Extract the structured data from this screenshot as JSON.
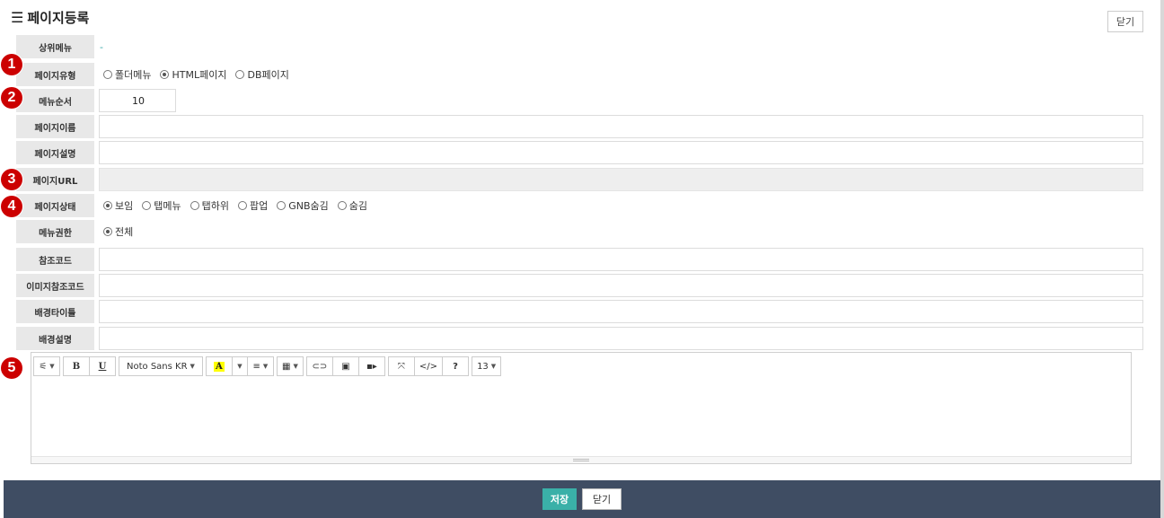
{
  "header": {
    "menu_icon": "☰",
    "title": "페이지등록",
    "close_label": "닫기"
  },
  "badges": [
    "1",
    "2",
    "3",
    "4",
    "5"
  ],
  "form": {
    "parent_menu": {
      "label": "상위메뉴",
      "value": "-"
    },
    "page_type": {
      "label": "페이지유형",
      "options": [
        "폴더메뉴",
        "HTML페이지",
        "DB페이지"
      ],
      "selected": "HTML페이지"
    },
    "menu_order": {
      "label": "메뉴순서",
      "value": "10"
    },
    "page_name": {
      "label": "페이지이름",
      "value": ""
    },
    "page_desc": {
      "label": "페이지설명",
      "value": ""
    },
    "page_url": {
      "label": "페이지URL",
      "value": ""
    },
    "page_status": {
      "label": "페이지상태",
      "options": [
        "보임",
        "탭메뉴",
        "탭하위",
        "팝업",
        "GNB숨김",
        "숨김"
      ],
      "selected": "보임"
    },
    "menu_permission": {
      "label": "메뉴권한",
      "options": [
        "전체"
      ],
      "selected": "전체"
    },
    "ref_code": {
      "label": "참조코드",
      "value": ""
    },
    "image_ref_code": {
      "label": "이미지참조코드",
      "value": ""
    },
    "bg_title": {
      "label": "배경타이틀",
      "value": ""
    },
    "bg_desc": {
      "label": "배경설명",
      "value": ""
    }
  },
  "editor": {
    "font_name": "Noto Sans KR",
    "font_size": "13",
    "bold": "B",
    "underline": "U",
    "color_letter": "A",
    "help": "?",
    "code": "</>"
  },
  "footer": {
    "save_label": "저장",
    "close_label": "닫기"
  },
  "colors": {
    "save_bg": "#3ab0a8",
    "footer_bg": "#3f4d63",
    "badge": "#cc0000",
    "label_bg": "#e8e8e8"
  }
}
